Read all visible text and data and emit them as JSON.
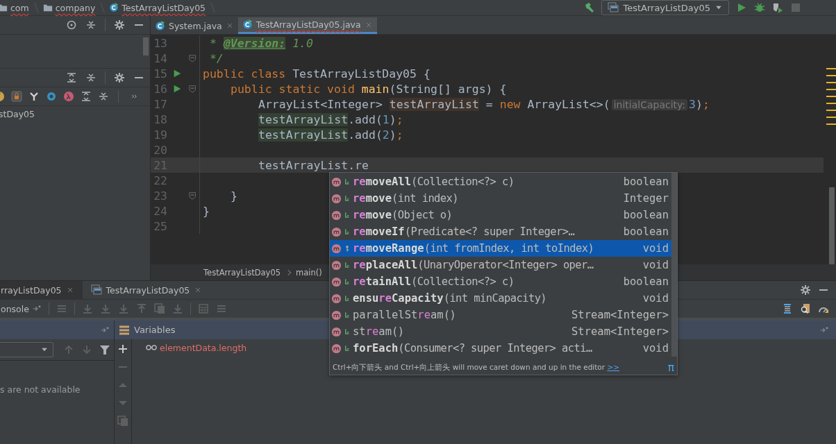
{
  "navigation_bar": {
    "breadcrumbs": [
      {
        "label": "com",
        "kind": "folder"
      },
      {
        "label": "company",
        "kind": "folder"
      },
      {
        "label": "TestArrayListDay05",
        "kind": "class"
      }
    ],
    "run_configuration": "TestArrayListDay05"
  },
  "project_panel": {
    "tree_item": "stDay05"
  },
  "editor": {
    "tabs": [
      {
        "label": "System.java",
        "selected": false
      },
      {
        "label": "TestArrayListDay05.java",
        "selected": true
      }
    ],
    "lines": [
      {
        "number": "13",
        "run": false,
        "fold": false,
        "current": false,
        "kind": "top-level",
        "tokens": [
          {
            "text": " * ",
            "kind": "comment"
          },
          {
            "text": "@Version:",
            "kind": "doc-tag"
          },
          {
            "text": " 1.0",
            "kind": "comment"
          }
        ]
      },
      {
        "number": "14",
        "run": false,
        "fold": true,
        "current": false,
        "kind": "top-level",
        "tokens": [
          {
            "text": " */",
            "kind": "comment"
          }
        ]
      },
      {
        "number": "15",
        "run": true,
        "fold": false,
        "current": false,
        "kind": "top-level",
        "tokens": [
          {
            "text": "public class ",
            "kind": "keyword"
          },
          {
            "text": "TestArrayListDay05 {",
            "kind": "plain"
          }
        ]
      },
      {
        "number": "16",
        "run": true,
        "fold": true,
        "current": false,
        "kind": "member",
        "tokens": [
          {
            "text": "public static void ",
            "kind": "keyword"
          },
          {
            "text": "main",
            "kind": "method"
          },
          {
            "text": "(String[] args) {",
            "kind": "plain"
          }
        ]
      },
      {
        "number": "17",
        "run": false,
        "fold": false,
        "current": false,
        "kind": "body",
        "tokens": [
          {
            "text": "ArrayList<Integer> ",
            "kind": "plain"
          },
          {
            "text": "testArrayList",
            "kind": "var-write"
          },
          {
            "text": " = ",
            "kind": "plain"
          },
          {
            "text": "new",
            "kind": "keyword"
          },
          {
            "text": " ArrayList<>(",
            "kind": "plain"
          },
          {
            "text": "initialCapacity:",
            "kind": "hint"
          },
          {
            "text": "3",
            "kind": "number"
          },
          {
            "text": ")",
            "kind": "plain"
          },
          {
            "text": ";",
            "kind": "keyword"
          }
        ]
      },
      {
        "number": "18",
        "run": false,
        "fold": false,
        "current": false,
        "kind": "body",
        "tokens": [
          {
            "text": "testArrayList",
            "kind": "var-read"
          },
          {
            "text": ".add(",
            "kind": "plain"
          },
          {
            "text": "1",
            "kind": "number"
          },
          {
            "text": ")",
            "kind": "plain"
          },
          {
            "text": ";",
            "kind": "keyword"
          }
        ]
      },
      {
        "number": "19",
        "run": false,
        "fold": false,
        "current": false,
        "kind": "body",
        "tokens": [
          {
            "text": "testArrayList",
            "kind": "var-read"
          },
          {
            "text": ".add(",
            "kind": "plain"
          },
          {
            "text": "2",
            "kind": "number"
          },
          {
            "text": ")",
            "kind": "plain"
          },
          {
            "text": ";",
            "kind": "keyword"
          }
        ]
      },
      {
        "number": "20",
        "run": false,
        "fold": false,
        "current": false
      },
      {
        "number": "21",
        "run": false,
        "fold": false,
        "current": true,
        "kind": "body",
        "tokens": [
          {
            "text": "testArrayList.re",
            "kind": "plain"
          }
        ]
      },
      {
        "number": "22",
        "run": false,
        "fold": false,
        "current": false
      },
      {
        "number": "23",
        "run": false,
        "fold": true,
        "current": false,
        "kind": "member",
        "tokens": [
          {
            "text": "}",
            "kind": "plain"
          }
        ]
      },
      {
        "number": "24",
        "run": false,
        "fold": false,
        "current": false,
        "kind": "top-level",
        "tokens": [
          {
            "text": "}",
            "kind": "plain"
          }
        ]
      },
      {
        "number": "25",
        "run": false,
        "fold": false,
        "current": false
      }
    ],
    "breadcrumbs": [
      "TestArrayListDay05",
      "main()"
    ]
  },
  "completion_popup": {
    "items": [
      {
        "parts": [
          {
            "text": "re",
            "match": true
          },
          {
            "text": "moveAll",
            "match": false
          }
        ],
        "bold": true,
        "params": "(Collection<?> c)",
        "type": "boolean",
        "kind": "public",
        "selected": false
      },
      {
        "parts": [
          {
            "text": "re",
            "match": true
          },
          {
            "text": "move",
            "match": false
          }
        ],
        "bold": true,
        "params": "(int index)",
        "type": "Integer",
        "kind": "public",
        "selected": false
      },
      {
        "parts": [
          {
            "text": "re",
            "match": true
          },
          {
            "text": "move",
            "match": false
          }
        ],
        "bold": true,
        "params": "(Object o)",
        "type": "boolean",
        "kind": "public",
        "selected": false
      },
      {
        "parts": [
          {
            "text": "re",
            "match": true
          },
          {
            "text": "moveIf",
            "match": false
          }
        ],
        "bold": true,
        "params": "(Predicate<? super Integer>…",
        "type": "boolean",
        "kind": "public",
        "selected": false
      },
      {
        "parts": [
          {
            "text": "re",
            "match": true
          },
          {
            "text": "moveRange",
            "match": false
          }
        ],
        "bold": true,
        "params": "(int fromIndex, int toIndex)",
        "type": "void",
        "kind": "protected",
        "selected": true
      },
      {
        "parts": [
          {
            "text": "re",
            "match": true
          },
          {
            "text": "placeAll",
            "match": false
          }
        ],
        "bold": true,
        "params": "(UnaryOperator<Integer> oper…",
        "type": "void",
        "kind": "public",
        "selected": false
      },
      {
        "parts": [
          {
            "text": "re",
            "match": true
          },
          {
            "text": "tainAll",
            "match": false
          }
        ],
        "bold": true,
        "params": "(Collection<?> c)",
        "type": "boolean",
        "kind": "public",
        "selected": false
      },
      {
        "parts": [
          {
            "text": "ensu",
            "match": false
          },
          {
            "text": "re",
            "match": true
          },
          {
            "text": "Capacity",
            "match": false
          }
        ],
        "bold": true,
        "params": "(int minCapacity)",
        "type": "void",
        "kind": "public",
        "selected": false
      },
      {
        "parts": [
          {
            "text": "parallelSt",
            "match": false
          },
          {
            "text": "re",
            "match": true
          },
          {
            "text": "am",
            "match": false
          }
        ],
        "bold": false,
        "params": "()",
        "type": "Stream<Integer>",
        "kind": "public",
        "selected": false
      },
      {
        "parts": [
          {
            "text": "st",
            "match": false
          },
          {
            "text": "re",
            "match": true
          },
          {
            "text": "am",
            "match": false
          }
        ],
        "bold": false,
        "params": "()",
        "type": "Stream<Integer>",
        "kind": "public",
        "selected": false
      },
      {
        "parts": [
          {
            "text": "forEach",
            "match": false
          }
        ],
        "bold": true,
        "params": "(Consumer<? super Integer> acti…",
        "type": "void",
        "kind": "public",
        "selected": false
      }
    ],
    "hint": "Ctrl+向下箭头 and Ctrl+向上箭头 will move caret down and up in the editor",
    "hint_link": ">>",
    "symbol": "π"
  },
  "debug_panel": {
    "tabs": [
      {
        "label": "rrayListDay05",
        "selected": true
      },
      {
        "label": "TestArrayListDay05",
        "selected": false
      }
    ],
    "console_tab": "onsole",
    "frames_message": "s are not available",
    "variables_title": "Variables",
    "watches": [
      "elementData.length"
    ]
  }
}
